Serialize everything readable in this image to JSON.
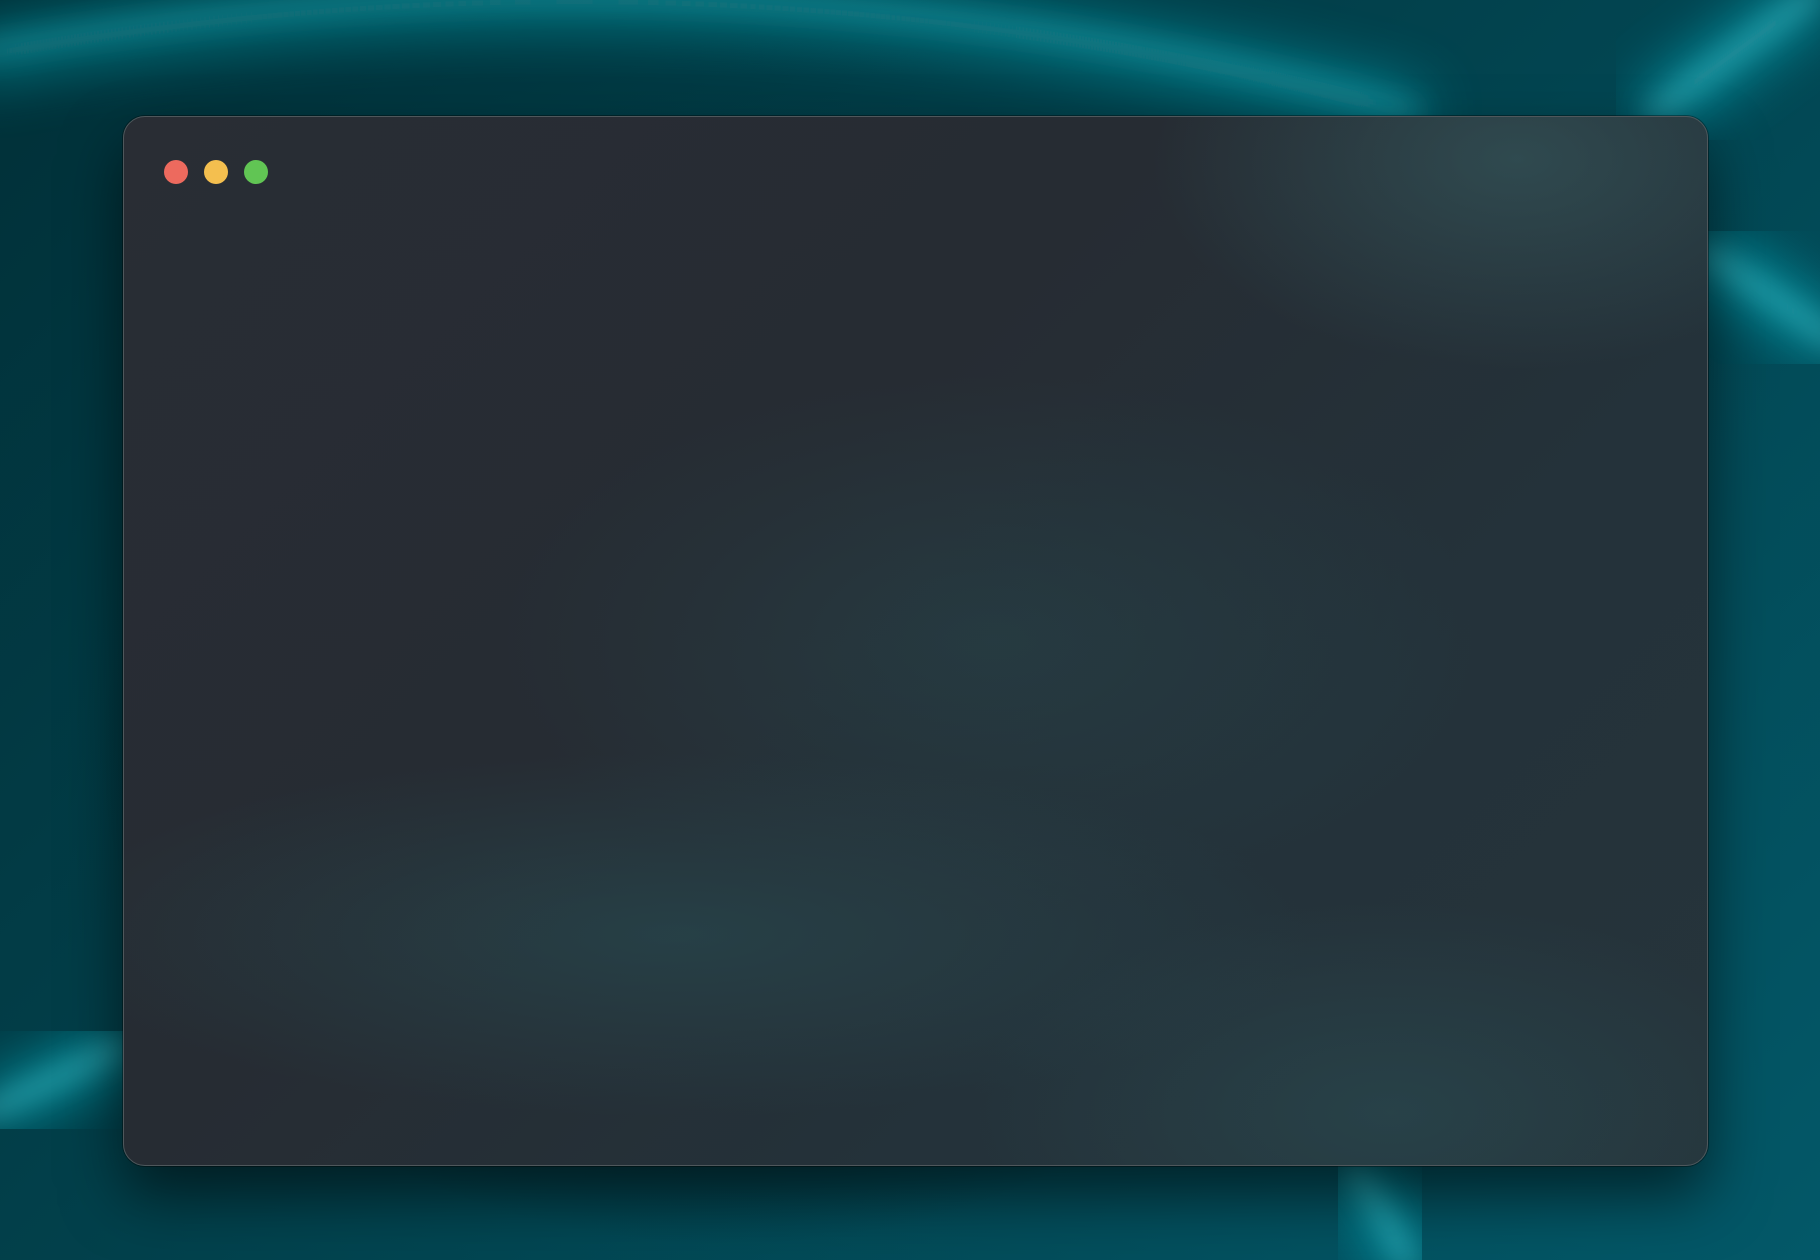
{
  "window": {
    "controls": [
      {
        "name": "close-button",
        "color": "#ed6a5e"
      },
      {
        "name": "minimize-button",
        "color": "#f4bf4f"
      },
      {
        "name": "maximize-button",
        "color": "#61c554"
      }
    ]
  },
  "colors": {
    "desktop_accent": "#1fe0ee",
    "window_background": "#262c33"
  }
}
